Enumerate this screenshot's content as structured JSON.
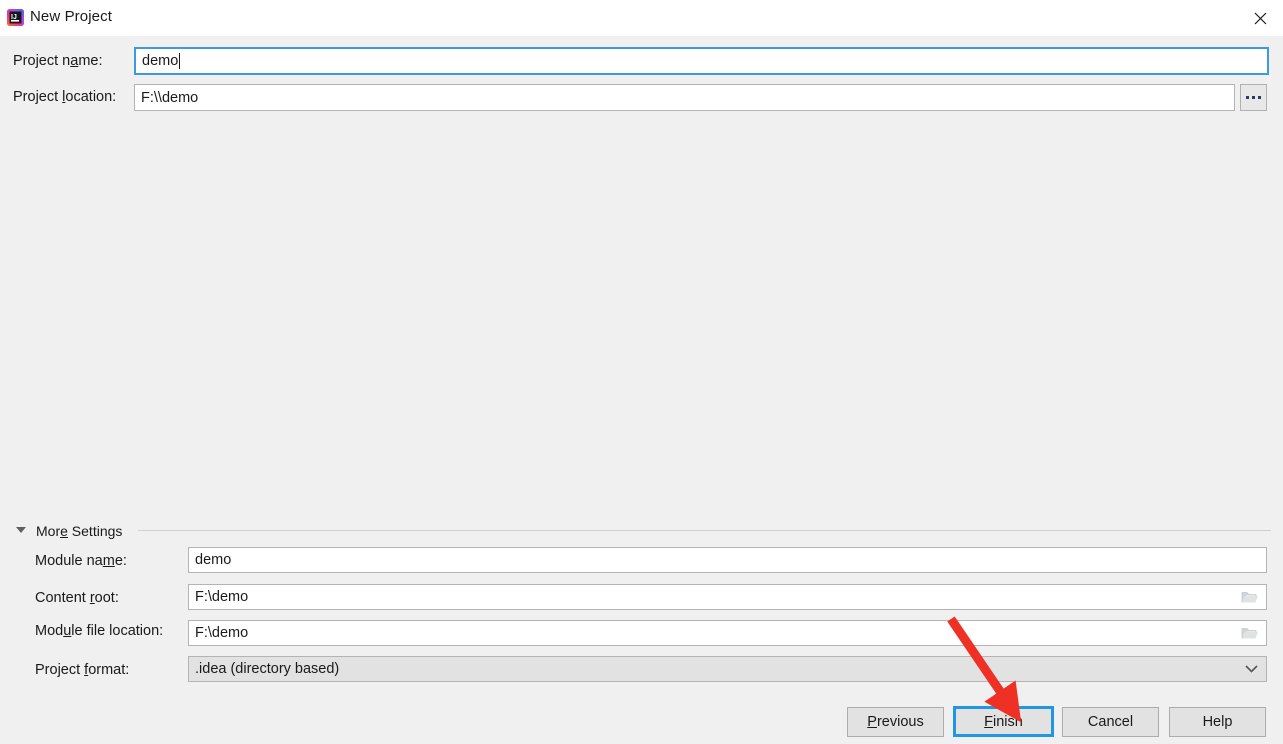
{
  "window": {
    "title": "New Project",
    "app_icon": "intellij-idea-icon",
    "close_icon": "close-icon"
  },
  "top_form": {
    "project_name": {
      "label_before": "Project n",
      "label_mnemonic": "a",
      "label_after": "me:",
      "value": "demo",
      "focused": true
    },
    "project_location": {
      "label_before": "Project ",
      "label_mnemonic": "l",
      "label_after": "ocation:",
      "value": "F:\\\\demo",
      "browse_label": "...",
      "browse_icon": "ellipsis-icon"
    }
  },
  "more_settings": {
    "label_before": "Mor",
    "label_mnemonic": "e",
    "label_after": " Settings",
    "expanded": true,
    "toggle_icon": "triangle-down-icon"
  },
  "settings_form": {
    "module_name": {
      "label_before": "Module na",
      "label_mnemonic": "m",
      "label_after": "e:",
      "value": "demo"
    },
    "content_root": {
      "label_before": "Content ",
      "label_mnemonic": "r",
      "label_after": "oot:",
      "value": "F:\\demo",
      "browse_icon": "folder-icon"
    },
    "module_file_location": {
      "label_before": "Mod",
      "label_mnemonic": "u",
      "label_after": "le file location:",
      "value": "F:\\demo",
      "browse_icon": "folder-icon"
    },
    "project_format": {
      "label_before": "Project ",
      "label_mnemonic": "f",
      "label_after": "ormat:",
      "value": ".idea (directory based)",
      "dropdown_icon": "chevron-down-icon"
    }
  },
  "buttons": {
    "previous": {
      "before": "",
      "mnemonic": "P",
      "after": "revious"
    },
    "finish": {
      "before": "",
      "mnemonic": "F",
      "after": "inish",
      "focused": true
    },
    "cancel": {
      "before": "Cancel",
      "mnemonic": "",
      "after": ""
    },
    "help": {
      "before": "Help",
      "mnemonic": "",
      "after": ""
    }
  },
  "annotation": {
    "type": "arrow",
    "color": "#ee3124",
    "points_to": "finish-button"
  },
  "colors": {
    "window_background": "#f0f0f0",
    "titlebar_background": "#ffffff",
    "focus_blue": "#2196e3",
    "field_border": "#b4b4b4",
    "annotation_red": "#ee3124"
  }
}
